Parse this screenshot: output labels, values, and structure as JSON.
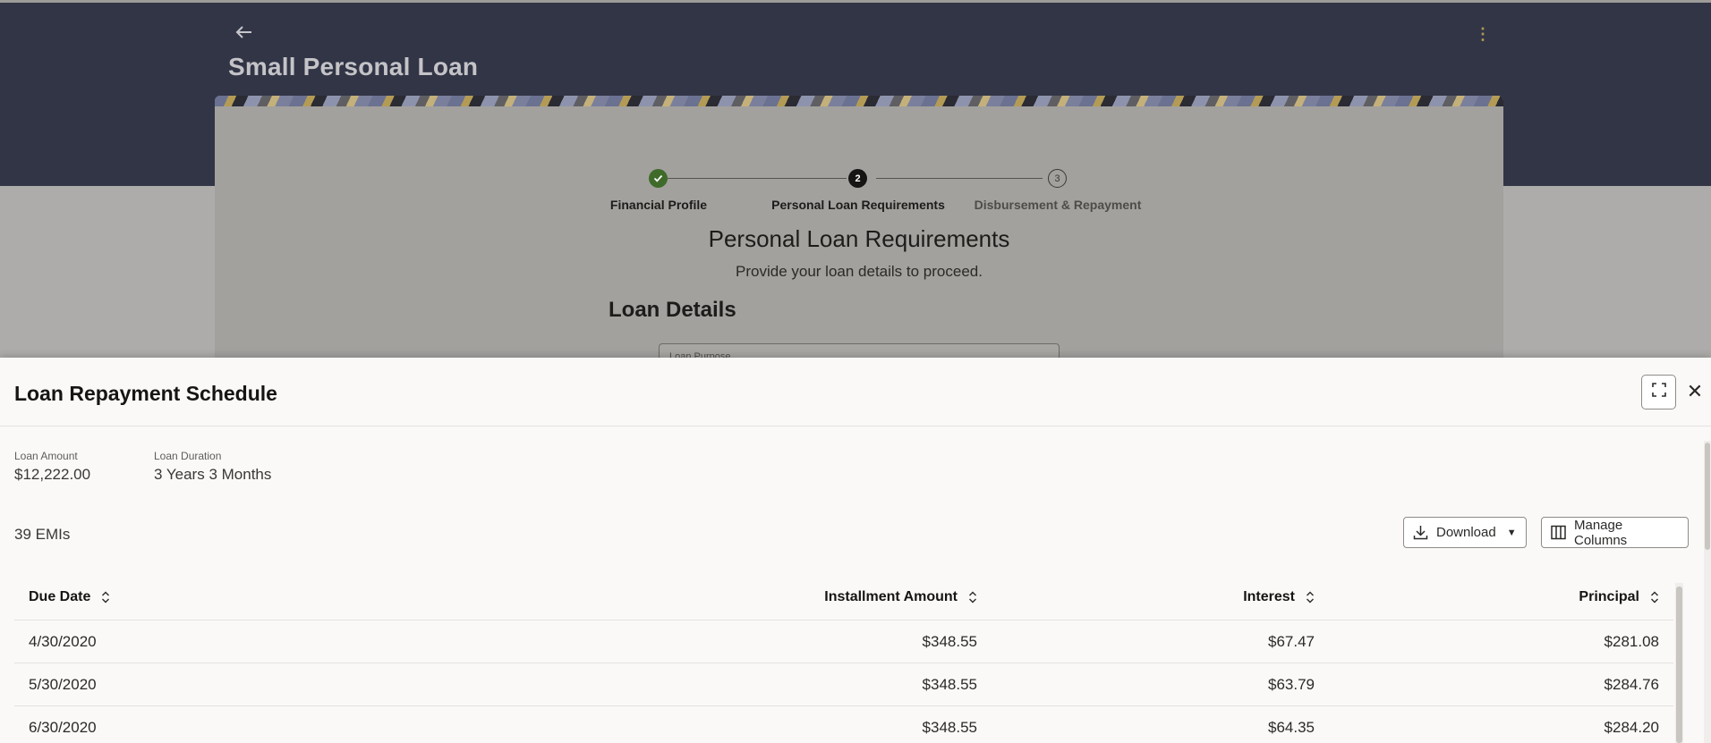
{
  "page": {
    "title": "Small Personal Loan",
    "stepper": [
      {
        "label": "Financial Profile",
        "state": "done"
      },
      {
        "label": "Personal Loan Requirements",
        "number": "2",
        "state": "current"
      },
      {
        "label": "Disbursement & Repayment",
        "number": "3",
        "state": "upcoming"
      }
    ],
    "section_heading": "Personal Loan Requirements",
    "section_subtitle": "Provide your loan details to proceed.",
    "loan_details_heading": "Loan Details",
    "loan_purpose_label": "Loan Purpose"
  },
  "drawer": {
    "title": "Loan Repayment Schedule",
    "summary": [
      {
        "label": "Loan Amount",
        "value": "$12,222.00"
      },
      {
        "label": "Loan Duration",
        "value": "3 Years 3 Months"
      }
    ],
    "emi_count": "39 EMIs",
    "download_label": "Download",
    "manage_columns_label": "Manage Columns",
    "table": {
      "columns": [
        "Due Date",
        "Installment Amount",
        "Interest",
        "Principal"
      ],
      "rows": [
        [
          "4/30/2020",
          "$348.55",
          "$67.47",
          "$281.08"
        ],
        [
          "5/30/2020",
          "$348.55",
          "$63.79",
          "$284.76"
        ],
        [
          "6/30/2020",
          "$348.55",
          "$64.35",
          "$284.20"
        ]
      ]
    }
  },
  "icons": {
    "back": "arrow-left-icon",
    "more": "kebab-menu-icon",
    "expand": "fullscreen-icon",
    "close": "close-icon",
    "download": "download-icon",
    "columns": "columns-icon",
    "sort": "sort-icon"
  },
  "colors": {
    "hero_background": "#323546",
    "step_done": "#3f6b2a",
    "step_current": "#161513"
  }
}
